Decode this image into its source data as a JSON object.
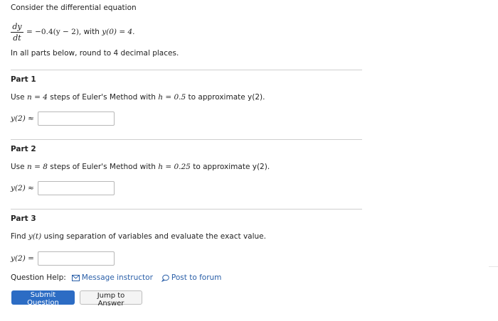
{
  "intro": {
    "text": "Consider the differential equation",
    "ode_numerator": "dy",
    "ode_denominator": "dt",
    "ode_rhs": "= −0.4(y − 2),",
    "with_text": "with",
    "initial": "y(0) = 4.",
    "rounding": "In all parts below, round to 4 decimal places."
  },
  "part1": {
    "title": "Part 1",
    "use": "Use",
    "n_expr": "n = 4",
    "mid": "steps of Euler's Method with",
    "h_expr": "h = 0.5",
    "tail": "to approximate y(2).",
    "answer_label": "y(2) ≈",
    "answer_value": ""
  },
  "part2": {
    "title": "Part 2",
    "use": "Use",
    "n_expr": "n = 8",
    "mid": "steps of Euler's Method with",
    "h_expr": "h = 0.25",
    "tail": "to approximate y(2).",
    "answer_label": "y(2) ≈",
    "answer_value": ""
  },
  "part3": {
    "title": "Part 3",
    "find": "Find",
    "yt": "y(t)",
    "tail": "using separation of variables and evaluate the exact value.",
    "answer_label": "y(2) =",
    "answer_value": ""
  },
  "help": {
    "label": "Question Help:",
    "message": "Message instructor",
    "forum": "Post to forum"
  },
  "buttons": {
    "submit": "Submit Question",
    "jump": "Jump to Answer"
  },
  "colors": {
    "primary": "#2c6cc4",
    "link": "#2a5fa8"
  }
}
